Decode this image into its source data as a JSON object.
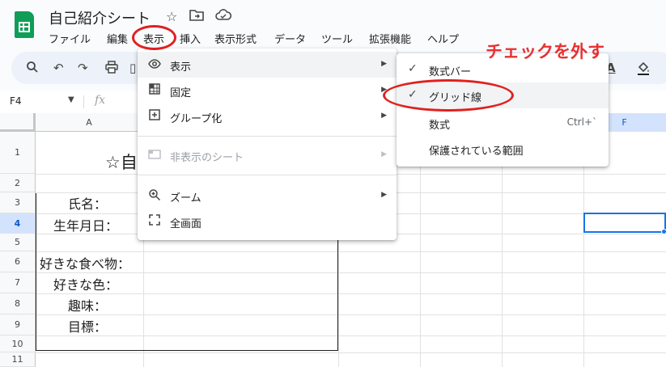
{
  "app": {
    "title": "自己紹介シート"
  },
  "menubar": [
    "ファイル",
    "編集",
    "表示",
    "挿入",
    "表示形式",
    "データ",
    "ツール",
    "拡張機能",
    "ヘルプ"
  ],
  "namebox": {
    "value": "F4"
  },
  "columns": [
    "A",
    "F"
  ],
  "rows": [
    "1",
    "2",
    "3",
    "4",
    "5",
    "6",
    "7",
    "8",
    "9",
    "10",
    "11"
  ],
  "cells": {
    "a1": "☆自",
    "a3": "氏名：",
    "a4": "生年月日：",
    "a6": "好きな食べ物：",
    "a7": "好きな色：",
    "a8": "趣味：",
    "a9": "目標："
  },
  "view_menu": {
    "items": [
      {
        "icon": "eye-icon",
        "label": "表示"
      },
      {
        "icon": "freeze-icon",
        "label": "固定"
      },
      {
        "icon": "group-icon",
        "label": "グループ化"
      },
      {
        "icon": "hidden-sheet-icon",
        "label": "非表示のシート"
      },
      {
        "icon": "zoom-icon",
        "label": "ズーム"
      },
      {
        "icon": "fullscreen-icon",
        "label": "全画面"
      }
    ]
  },
  "show_submenu": {
    "items": [
      {
        "label": "数式バー",
        "checked": true
      },
      {
        "label": "グリッド線",
        "checked": true
      },
      {
        "label": "数式",
        "shortcut": "Ctrl+`"
      },
      {
        "label": "保護されている範囲"
      }
    ]
  },
  "annotation": {
    "text": "チェックを外す",
    "color": "#e83030"
  },
  "colors": {
    "accent": "#1a73e8",
    "logo": "#0f9d58",
    "annotation_ring": "#e02020"
  }
}
